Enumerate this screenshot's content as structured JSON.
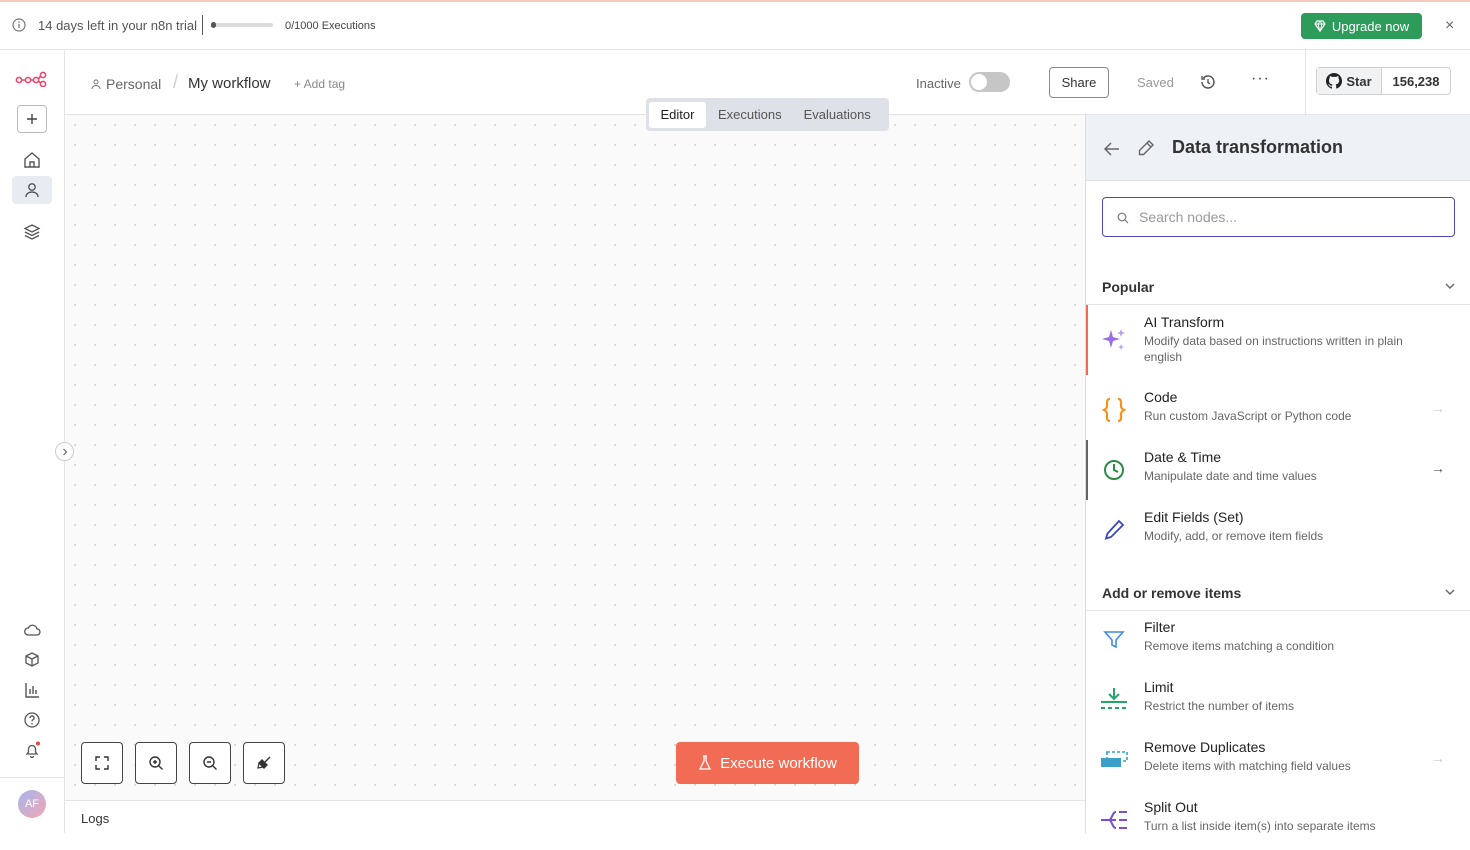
{
  "banner": {
    "trial_text": "14 days left in your n8n trial",
    "executions": "0/1000 Executions",
    "executions_used": 0,
    "executions_limit": 1000,
    "upgrade_label": "Upgrade now",
    "close_label": "×"
  },
  "header": {
    "project": "Personal",
    "workflow_name": "My workflow",
    "add_tag": "+ Add tag",
    "status_label": "Inactive",
    "active": false,
    "share_label": "Share",
    "saved_label": "Saved",
    "more_label": "···"
  },
  "github": {
    "star_label": "Star",
    "stars": "156,238"
  },
  "tabs": [
    {
      "label": "Editor",
      "active": true
    },
    {
      "label": "Executions",
      "active": false
    },
    {
      "label": "Evaluations",
      "active": false
    }
  ],
  "canvas": {
    "execute_label": "Execute workflow"
  },
  "logs": {
    "label": "Logs"
  },
  "sidebar": {
    "avatar_initials": "AF"
  },
  "panel": {
    "title": "Data transformation",
    "search_placeholder": "Search nodes...",
    "sections": [
      {
        "title": "Popular",
        "items": [
          {
            "name": "AI Transform",
            "desc": "Modify data based on instructions written in plain english",
            "icon": "sparkles-icon",
            "color": "#9b6ee6"
          },
          {
            "name": "Code",
            "desc": "Run custom JavaScript or Python code",
            "icon": "code-braces-icon",
            "color": "#f7931a"
          },
          {
            "name": "Date & Time",
            "desc": "Manipulate date and time values",
            "icon": "clock-icon",
            "color": "#2d8a4a"
          },
          {
            "name": "Edit Fields (Set)",
            "desc": "Modify, add, or remove item fields",
            "icon": "pen-icon",
            "color": "#3b45c0"
          }
        ]
      },
      {
        "title": "Add or remove items",
        "items": [
          {
            "name": "Filter",
            "desc": "Remove items matching a condition",
            "icon": "filter-icon",
            "color": "#3e8ed8"
          },
          {
            "name": "Limit",
            "desc": "Restrict the number of items",
            "icon": "limit-icon",
            "color": "#27a567"
          },
          {
            "name": "Remove Duplicates",
            "desc": "Delete items with matching field values",
            "icon": "duplicates-icon",
            "color": "#3aa0c8"
          },
          {
            "name": "Split Out",
            "desc": "Turn a list inside item(s) into separate items",
            "icon": "split-out-icon",
            "color": "#7b4fd0"
          }
        ]
      }
    ]
  },
  "colors": {
    "accent": "#f26c55",
    "upgrade": "#2d9b5a",
    "search_border": "#4d48b3",
    "highlight_bar": "#f26c55"
  }
}
